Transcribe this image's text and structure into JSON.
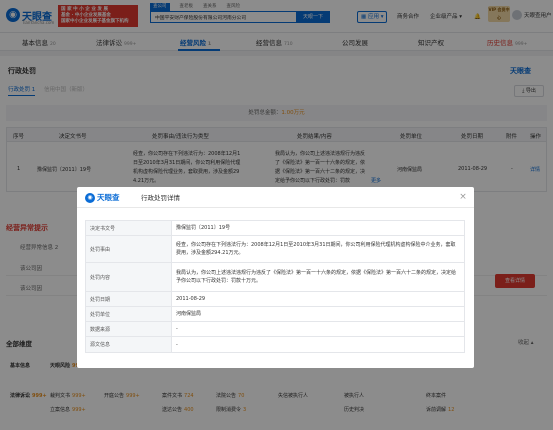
{
  "header": {
    "logo_name": "天眼查",
    "logo_domain": "TianYancha.com",
    "promo_lines": [
      "国 家 中 小 企 业 发 展 ",
      "基金 · 中小企业发展基金",
      "国家中小企业发展子基金旗下机构"
    ],
    "search_tabs": [
      "查公司",
      "查老板",
      "查关系",
      "查风险"
    ],
    "search_value": "中国平安财产保险股份有限公司河南分公司",
    "search_button": "天眼一下",
    "app_label": "应用",
    "nav_items": [
      "商务合作",
      "企业级产品"
    ],
    "vip_label": "VIP 会员中心",
    "user_name": "天眼查用户"
  },
  "section_tabs": [
    {
      "label": "基本信息",
      "count": "20"
    },
    {
      "label": "法律诉讼",
      "count": "999+"
    },
    {
      "label": "经营风险",
      "count": "1"
    },
    {
      "label": "经营信息",
      "count": "710"
    },
    {
      "label": "公司发展",
      "count": ""
    },
    {
      "label": "知识产权",
      "count": ""
    },
    {
      "label": "历史信息",
      "count": "999+"
    }
  ],
  "main": {
    "section_title": "行政处罚",
    "watermark": "天眼查",
    "sub_tabs": [
      "行政处罚 1",
      "信用中国（新版）"
    ],
    "export_label": "导出",
    "summary_prefix": "处罚总金额：",
    "summary_amount": "1.00万元",
    "table_headers": [
      "序号",
      "决定文书号",
      "处罚事由/违法行为类型",
      "处罚结果/内容",
      "处罚单位",
      "处罚日期",
      "附件",
      "操作"
    ],
    "row": {
      "index": "1",
      "doc_no": "豫保监罚〔2011〕19号",
      "reason_1": "经查，你公司存在下列违法行为：2008年12月1",
      "reason_2": "日至2010年3月31日期间，你公司利用保险代理",
      "reason_3": "机构虚构保险代理业务，套取费用，涉及金额29",
      "reason_4": "4.21万元。",
      "result_1": "我局认为，你公司上述违法违规行为违反",
      "result_2": "了《保险法》第一百一十六条的规定，依",
      "result_3": "据《保险法》第一百六十二条的规定，决",
      "result_4": "定给予你公司以下行政处罚：罚款",
      "more": "更多",
      "org": "河南保监局",
      "date": "2011-08-29",
      "attachment": "-",
      "action": "详情"
    }
  },
  "risk": {
    "title": "经营异常提示",
    "sub_label": "经营异常信息 2",
    "rows": [
      "该公司因",
      "该公司因"
    ],
    "button": "查看详情"
  },
  "dimensions": {
    "title": "全部维度",
    "collapse": "收起",
    "row1": [
      {
        "label": "基本信息",
        "count": ""
      },
      {
        "label": "天眼风险",
        "count": "999+"
      }
    ],
    "row2": [
      {
        "label": "法律诉讼",
        "count": "999+"
      },
      {
        "label": "裁判文书",
        "count": "999+"
      },
      {
        "label": "开庭公告",
        "count": "999+"
      },
      {
        "label": "案件文书",
        "count": "724"
      },
      {
        "label": "法院公告",
        "count": "70"
      },
      {
        "label": "失信被执行人",
        "count": ""
      },
      {
        "label": "被执行人",
        "count": ""
      },
      {
        "label": "终本案件",
        "count": ""
      }
    ],
    "row3": [
      {
        "label": "立案信息",
        "count": "999+"
      },
      {
        "label": "送达公告",
        "count": "400"
      },
      {
        "label": "限制消费令",
        "count": "3"
      },
      {
        "label": "历史判决",
        "count": ""
      },
      {
        "label": "诉前调解",
        "count": "12"
      }
    ]
  },
  "modal": {
    "logo_name": "天眼查",
    "title": "行政处罚详情",
    "close_glyph": "×",
    "fields": [
      {
        "key": "决定书文号",
        "value": "豫保监罚〔2011〕19号"
      },
      {
        "key": "处罚事由",
        "value": "经查，你公司存在下列违法行为：2008年12月1日至2010年3月31日期间，你公司利用保险代理机构虚构保险中介业务，套取费用，涉及金额294.21万元。"
      },
      {
        "key": "处罚内容",
        "value": "我局认为，你公司上述违法违规行为违反了《保险法》第一百一十六条的规定，依据《保险法》第一百六十二条的规定，决定给予你公司以下行政处罚：罚款十万元。"
      },
      {
        "key": "处罚日期",
        "value": "2011-08-29"
      },
      {
        "key": "处罚单位",
        "value": "河南保监局"
      },
      {
        "key": "数据来源",
        "value": "-"
      },
      {
        "key": "源文信息",
        "value": "-"
      }
    ]
  }
}
